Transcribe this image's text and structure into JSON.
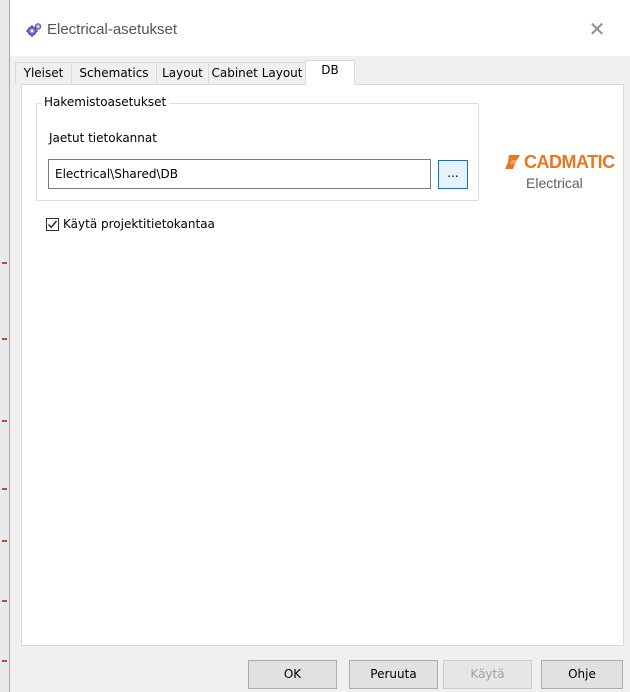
{
  "window": {
    "title": "Electrical-asetukset",
    "close_glyph": "✕",
    "icon": "gear-icon"
  },
  "tabs": [
    {
      "label": "Yleiset",
      "active": false
    },
    {
      "label": "Schematics",
      "active": false
    },
    {
      "label": "Layout",
      "active": false
    },
    {
      "label": "Cabinet Layout",
      "active": false
    },
    {
      "label": "DB",
      "active": true
    }
  ],
  "db_tab": {
    "group_title": "Hakemistoasetukset",
    "shared_db_label": "Jaetut tietokannat",
    "shared_db_path": "Electrical\\Shared\\DB",
    "browse_label": "...",
    "use_project_db_label": "Käytä projektitietokantaa",
    "use_project_db_checked": true
  },
  "logo": {
    "brand": "CADMATIC",
    "product": "Electrical",
    "brand_color": "#e87722"
  },
  "buttons": {
    "ok": "OK",
    "cancel": "Peruuta",
    "apply": "Käytä",
    "help": "Ohje"
  },
  "colors": {
    "accent": "#0078d7",
    "panel_bg": "#ffffff",
    "dialog_bg": "#f0f0f0"
  }
}
